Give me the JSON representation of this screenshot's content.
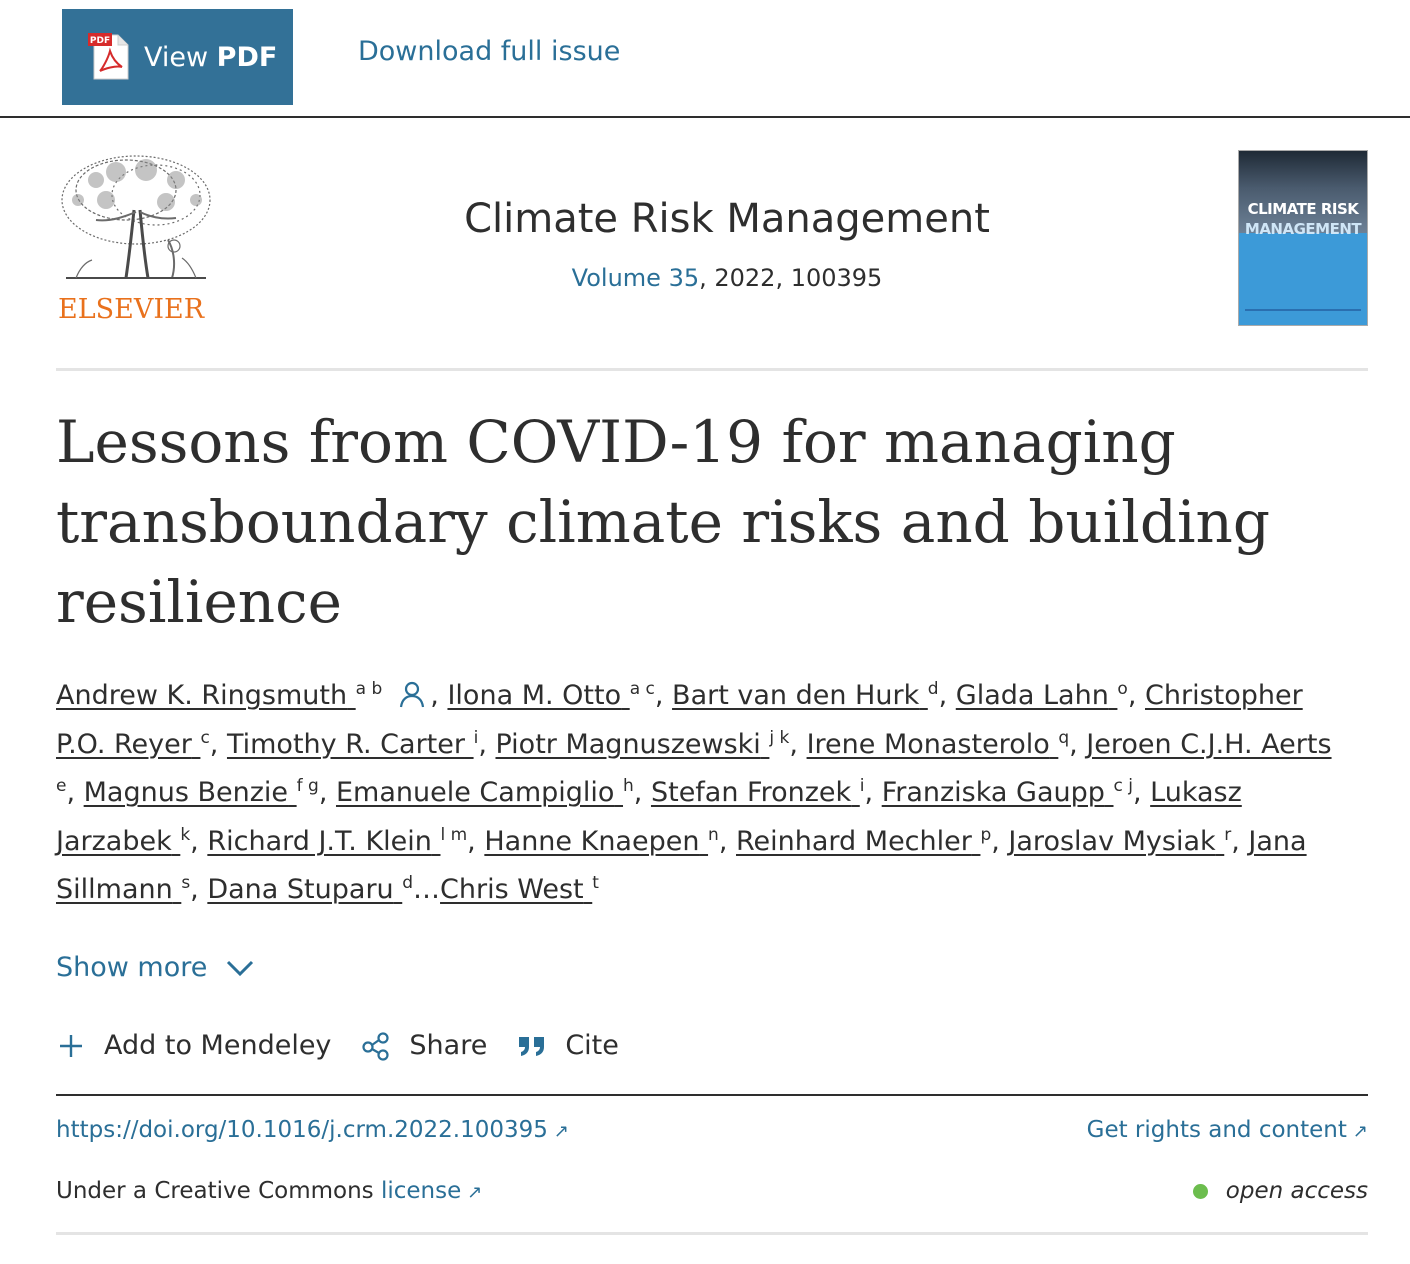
{
  "toolbar": {
    "view_pdf_prefix": "View ",
    "view_pdf_bold": "PDF",
    "pdf_badge": "PDF",
    "download_issue": "Download full issue"
  },
  "journal": {
    "publisher": "ELSEVIER",
    "title": "Climate Risk Management",
    "volume_link": "Volume 35",
    "meta_rest": ", 2022, 100395",
    "cover_line1": "CLIMATE RISK",
    "cover_line2": "MANAGEMENT"
  },
  "article": {
    "title": "Lessons from COVID-19 for managing transboundary climate risks and building resilience"
  },
  "authors": [
    {
      "name": "Andrew K. Ringsmuth",
      "aff": "a b"
    },
    {
      "name": "Ilona M. Otto",
      "aff": "a c"
    },
    {
      "name": "Bart van den Hurk",
      "aff": "d"
    },
    {
      "name": "Glada Lahn",
      "aff": "o"
    },
    {
      "name": "Christopher P.O. Reyer",
      "aff": "c"
    },
    {
      "name": "Timothy R. Carter",
      "aff": "i"
    },
    {
      "name": "Piotr Magnuszewski",
      "aff": "j k"
    },
    {
      "name": "Irene Monasterolo",
      "aff": "q"
    },
    {
      "name": "Jeroen C.J.H. Aerts",
      "aff": "e"
    },
    {
      "name": "Magnus Benzie",
      "aff": "f g"
    },
    {
      "name": "Emanuele Campiglio",
      "aff": "h"
    },
    {
      "name": "Stefan Fronzek",
      "aff": "i"
    },
    {
      "name": "Franziska Gaupp",
      "aff": "c j"
    },
    {
      "name": "Lukasz Jarzabek",
      "aff": "k"
    },
    {
      "name": "Richard J.T. Klein",
      "aff": "l m"
    },
    {
      "name": "Hanne Knaepen",
      "aff": "n"
    },
    {
      "name": "Reinhard Mechler",
      "aff": "p"
    },
    {
      "name": "Jaroslav Mysiak",
      "aff": "r"
    },
    {
      "name": "Jana Sillmann",
      "aff": "s"
    },
    {
      "name": "Dana Stuparu",
      "aff": "d"
    },
    {
      "name": "Chris West",
      "aff": "t"
    }
  ],
  "authors_ellipsis": "…",
  "show_more": "Show more",
  "actions": {
    "mendeley": "Add to Mendeley",
    "share": "Share",
    "cite": "Cite"
  },
  "links": {
    "doi": "https://doi.org/10.1016/j.crm.2022.100395",
    "rights": "Get rights and content",
    "license_prefix": "Under a Creative Commons ",
    "license_link": "license",
    "open_access": "open access"
  },
  "colors": {
    "brand_blue": "#337197",
    "link_blue": "#2a6f97",
    "elsevier_orange": "#e9711c",
    "oa_green": "#6cbd4e",
    "text": "#2e2e2e"
  }
}
